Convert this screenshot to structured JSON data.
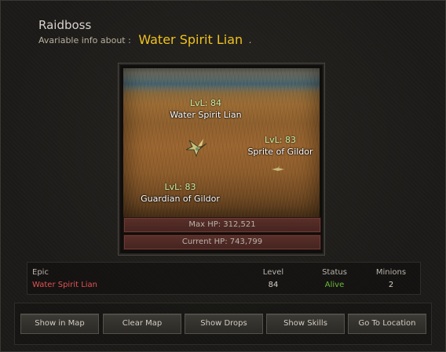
{
  "window": {
    "title": "Raidboss",
    "subtitle_prefix": "Avariable info about :",
    "boss_name": "Water Spirit Lian",
    "subtitle_suffix": "."
  },
  "map": {
    "markers": [
      {
        "level": "LvL: 84",
        "name": "Water Spirit Lian"
      },
      {
        "level": "LvL: 83",
        "name": "Sprite of Gildor"
      },
      {
        "level": "LvL: 83",
        "name": "Guardian of Gildor"
      }
    ],
    "max_hp": "Max HP: 312,521",
    "current_hp": "Current HP: 743,799"
  },
  "info_table": {
    "headers": {
      "type": "Epic",
      "level": "Level",
      "status": "Status",
      "minions": "Minions"
    },
    "row": {
      "name": "Water Spirit Lian",
      "level": "84",
      "status": "Alive",
      "minions": "2"
    },
    "colors": {
      "name": "#e35252",
      "status": "#6abb3a",
      "value": "#d6d0c6"
    }
  },
  "buttons": {
    "show_in_map": "Show in Map",
    "clear_map": "Clear Map",
    "show_drops": "Show Drops",
    "show_skills": "Show Skills",
    "go_to_location": "Go To Location"
  },
  "colors": {
    "boss_name": "#f0c21e",
    "level_label": "#c9f0a6"
  }
}
